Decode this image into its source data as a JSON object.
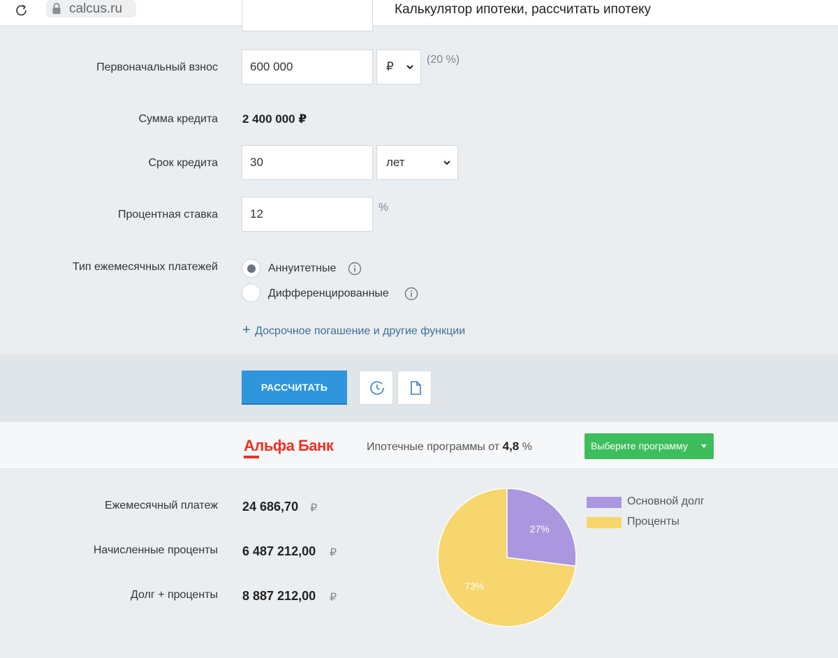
{
  "browser": {
    "url": "calcus.ru",
    "page_title": "Калькулятор ипотеки, рассчитать ипотеку"
  },
  "form": {
    "down_payment": {
      "label": "Первоначальный взнос",
      "value": "600 000",
      "unit": "₽",
      "hint": "(20 %)"
    },
    "loan_amount": {
      "label": "Сумма кредита",
      "value": "2 400 000 ₽"
    },
    "term": {
      "label": "Срок кредита",
      "value": "30",
      "unit": "лет"
    },
    "rate": {
      "label": "Процентная ставка",
      "value": "12",
      "hint": "%"
    },
    "payment_type": {
      "label": "Тип ежемесячных платежей",
      "options": [
        {
          "label": "Аннуитетные",
          "checked": true
        },
        {
          "label": "Дифференцированные",
          "checked": false
        }
      ]
    },
    "more_link": "Досрочное погашение и другие функции",
    "more_link_symbol": "+"
  },
  "actions": {
    "calculate_label": "РАССЧИТАТЬ",
    "history_icon": "clock-icon",
    "document_icon": "document-icon"
  },
  "bank": {
    "name": "Альфа Банк",
    "promo_text": "Ипотечные программы от ",
    "promo_rate": "4,8",
    "promo_unit": " %",
    "program_button": "Выберите программу",
    "brand_color": "#ef3124",
    "button_color": "#3ebd5c"
  },
  "results": {
    "monthly_payment": {
      "label": "Ежемесячный платеж",
      "value": "24 686,70",
      "currency": "₽"
    },
    "interest": {
      "label": "Начисленные проценты",
      "value": "6 487 212,00",
      "currency": "₽"
    },
    "total": {
      "label": "Долг + проценты",
      "value": "8 887 212,00",
      "currency": "₽"
    }
  },
  "chart_data": {
    "type": "pie",
    "slices": [
      {
        "name": "Основной долг",
        "value": 27,
        "label": "27%",
        "color": "#ab97e0"
      },
      {
        "name": "Проценты",
        "value": 73,
        "label": "73%",
        "color": "#f8d66e"
      }
    ],
    "legend_placement": "right"
  }
}
